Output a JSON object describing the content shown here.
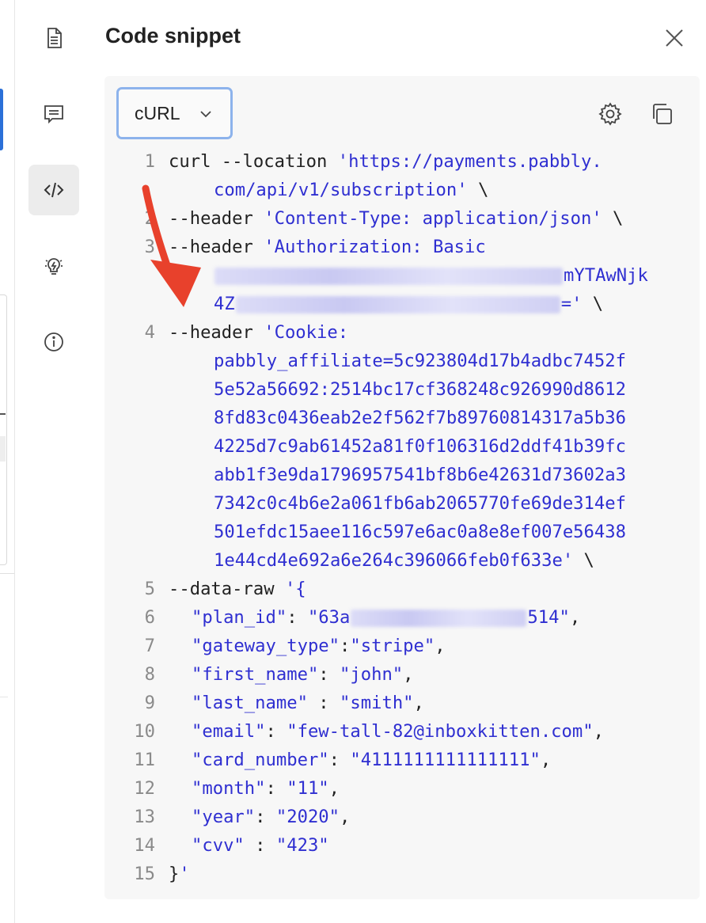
{
  "title": "Code snippet",
  "language_select": {
    "value": "cURL"
  },
  "icons": {
    "rail": [
      "document-icon",
      "comment-icon",
      "code-icon",
      "lightbulb-icon",
      "info-icon"
    ],
    "close": "close-icon",
    "settings": "gear-icon",
    "copy": "copy-icon",
    "chevron": "chevron-down-icon"
  },
  "colors": {
    "string": "#2f2fd1",
    "select_border": "#8db3ec",
    "active_rail": "#ececec",
    "annotation_arrow": "#e8412c"
  },
  "code": {
    "line_numbers": [
      "1",
      "2",
      "3",
      "4",
      "5",
      "6",
      "7",
      "8",
      "9",
      "10",
      "11",
      "12",
      "13",
      "14",
      "15"
    ],
    "l1a_plain": "curl --location ",
    "l1a_str": "'https://payments.pabbly.",
    "l1b_str": "com/api/v1/subscription'",
    "l1b_plain": " \\",
    "l2_plain": "--header ",
    "l2_str": "'Content-Type: application/json'",
    "l2_tail": " \\",
    "l3a_plain": "--header ",
    "l3a_str": "'Authorization: Basic",
    "l3b_str": "mYTAwNjk",
    "l3c_str1": "4Z",
    "l3c_str2": "='",
    "l3c_tail": " \\",
    "l4a_plain": "--header ",
    "l4a_str": "'Cookie:",
    "l4b_str": "pabbly_affiliate=5c923804d17b4adbc7452f",
    "l4c_str": "5e52a56692:2514bc17cf368248c926990d8612",
    "l4d_str": "8fd83c0436eab2e2f562f7b89760814317a5b36",
    "l4e_str": "4225d7c9ab61452a81f0f106316d2ddf41b39fc",
    "l4f_str": "abb1f3e9da1796957541bf8b6e42631d73602a3",
    "l4g_str": "7342c0c4b6e2a061fb6ab2065770fe69de314ef",
    "l4h_str": "501efdc15aee116c597e6ac0a8e8ef007e56438",
    "l4i_str": "1e44cd4e692a6e264c396066feb0f633e'",
    "l4i_tail": " \\",
    "l5_plain": "--data-raw ",
    "l5_str": "'{",
    "l6_key": "\"plan_id\"",
    "l6_sep": ": ",
    "l6_val1": "\"63a",
    "l6_val2": "514\"",
    "l6_tail": ",",
    "l7_key": "\"gateway_type\"",
    "l7_sep": ":",
    "l7_val": "\"stripe\"",
    "l7_tail": ",",
    "l8_key": "\"first_name\"",
    "l8_sep": ": ",
    "l8_val": "\"john\"",
    "l8_tail": ",",
    "l9_key": "\"last_name\"",
    "l9_sep": " : ",
    "l9_val": "\"smith\"",
    "l9_tail": ",",
    "l10_key": "\"email\"",
    "l10_sep": ": ",
    "l10_val": "\"few-tall-82@inboxkitten.com\"",
    "l10_tail": ",",
    "l11_key": "\"card_number\"",
    "l11_sep": ": ",
    "l11_val": "\"4111111111111111\"",
    "l11_tail": ",",
    "l12_key": "\"month\"",
    "l12_sep": ": ",
    "l12_val": "\"11\"",
    "l12_tail": ",",
    "l13_key": "\"year\"",
    "l13_sep": ": ",
    "l13_val": "\"2020\"",
    "l13_tail": ",",
    "l14_key": "\"cvv\"",
    "l14_sep": " : ",
    "l14_val": "\"423\"",
    "l15_plain": "}",
    "l15_str": "'"
  }
}
